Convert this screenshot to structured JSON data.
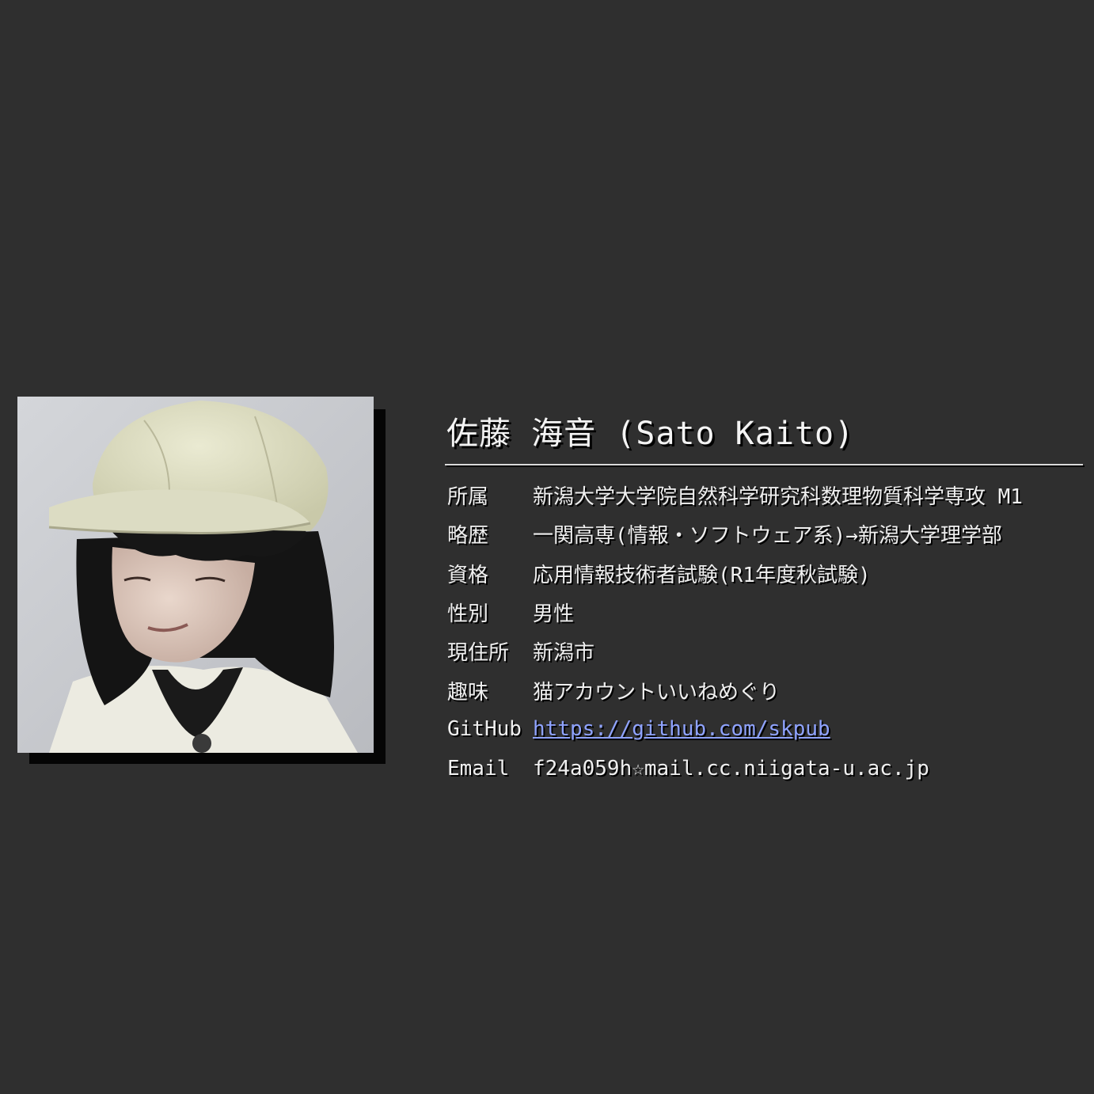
{
  "profile": {
    "name": "佐藤 海音 (Sato Kaito)",
    "photo_alt": "profile-photo",
    "rows": [
      {
        "label": "所属",
        "value": "新潟大学大学院自然科学研究科数理物質科学専攻 M1"
      },
      {
        "label": "略歴",
        "value": "一関高専(情報・ソフトウェア系)→新潟大学理学部"
      },
      {
        "label": "資格",
        "value": "応用情報技術者試験(R1年度秋試験)"
      },
      {
        "label": "性別",
        "value": "男性"
      },
      {
        "label": "現住所",
        "value": "新潟市"
      },
      {
        "label": "趣味",
        "value": "猫アカウントいいねめぐり"
      },
      {
        "label": "GitHub",
        "value": "https://github.com/skpub"
      },
      {
        "label": "Email",
        "value": "f24a059h☆mail.cc.niigata-u.ac.jp"
      }
    ]
  },
  "colors": {
    "background": "#2f2f2f",
    "text": "#efefef",
    "link": "#8fa3ff",
    "shadow": "#000000"
  }
}
